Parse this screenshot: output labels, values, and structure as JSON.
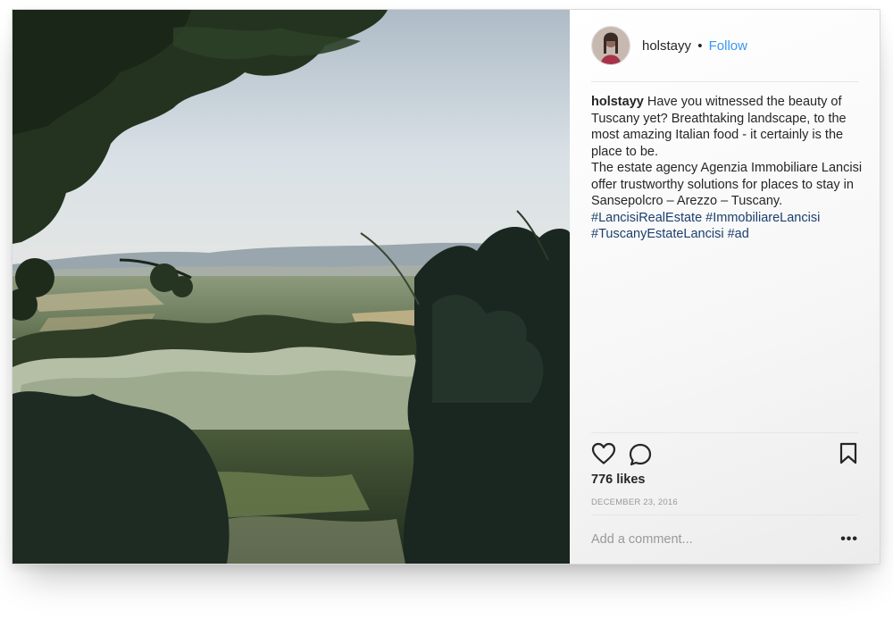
{
  "post": {
    "username": "holstayy",
    "separator": "•",
    "follow_label": "Follow",
    "caption": {
      "username": "holstayy",
      "lines": [
        "Have you witnessed the beauty of Tuscany yet? Breathtaking landscape, to the most amazing Italian food - it certainly is the place to be.",
        "The estate agency Agenzia Immobiliare Lancisi offer trustworthy solutions for places to stay in Sansepolcro – Arezzo – Tuscany."
      ],
      "hashtags": [
        "#LancisiRealEstate",
        "#ImmobiliareLancisi",
        "#TuscanyEstateLancisi",
        "#ad"
      ]
    },
    "likes": "776 likes",
    "date": "DECEMBER 23, 2016",
    "comment_placeholder": "Add a comment...",
    "more_label": "•••"
  },
  "icons": {
    "like": "heart-icon",
    "comment": "comment-bubble-icon",
    "save": "bookmark-icon",
    "more": "more-options-icon"
  },
  "colors": {
    "link_blue": "#3897f0",
    "hashtag": "#1c3f6e",
    "text": "#262626",
    "muted": "#999999"
  }
}
